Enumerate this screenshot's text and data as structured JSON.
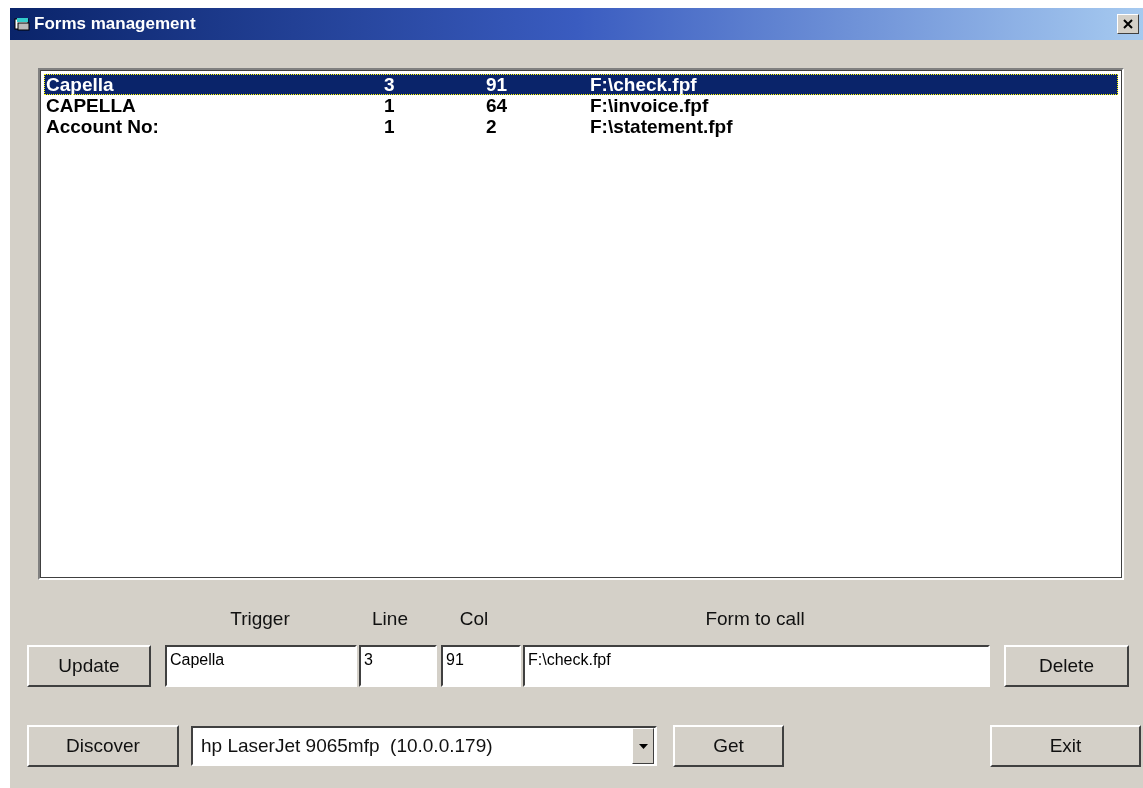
{
  "window": {
    "title": "Forms management"
  },
  "list": {
    "rows": [
      {
        "trigger": "Capella",
        "line": "3",
        "col": "91",
        "form": "F:\\check.fpf",
        "selected": true
      },
      {
        "trigger": "CAPELLA",
        "line": "1",
        "col": "64",
        "form": "F:\\invoice.fpf",
        "selected": false
      },
      {
        "trigger": "Account No:",
        "line": "1",
        "col": "2",
        "form": "F:\\statement.fpf",
        "selected": false
      }
    ]
  },
  "editor": {
    "labels": [
      "Trigger",
      "Line",
      "Col",
      "Form to call"
    ],
    "trigger": "Capella",
    "line": "3",
    "col": "91",
    "form": "F:\\check.fpf"
  },
  "buttons": {
    "update": "Update",
    "delete": "Delete",
    "discover": "Discover",
    "get": "Get",
    "exit": "Exit"
  },
  "printer": {
    "value": "hp LaserJet 9065mfp  (10.0.0.179)"
  }
}
